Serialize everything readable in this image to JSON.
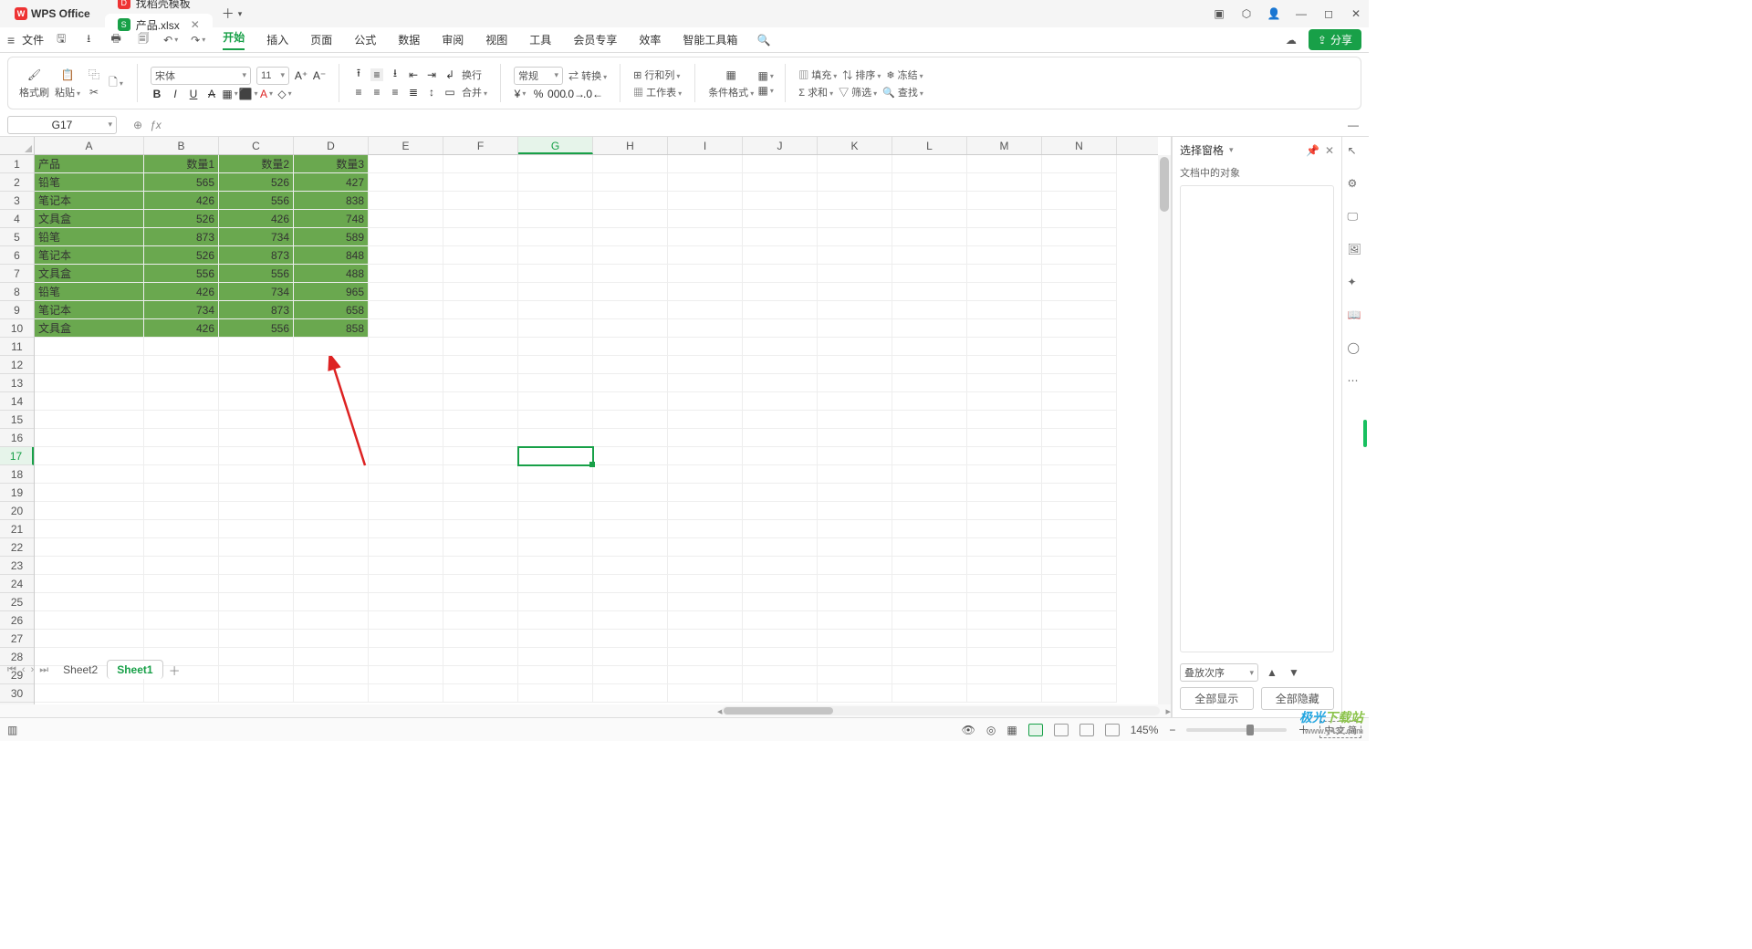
{
  "titlebar": {
    "app": "WPS Office",
    "tabs": [
      {
        "icon": "D",
        "icon_bg": "#e33",
        "label": "找稻壳模板"
      },
      {
        "icon": "S",
        "icon_bg": "#18a048",
        "label": "产品.xlsx",
        "active": true,
        "closable": true
      }
    ],
    "right_icons": [
      "window-mode-icon",
      "cube-icon",
      "avatar-icon",
      "minimize-icon",
      "maximize-icon",
      "close-icon"
    ]
  },
  "menubar": {
    "file_label": "文件",
    "quick_icons": [
      "save-icon",
      "print-icon",
      "print-preview-icon",
      "redo-dd-icon",
      "undo-icon",
      "undo-dd-icon"
    ],
    "tabs": [
      "开始",
      "插入",
      "页面",
      "公式",
      "数据",
      "审阅",
      "视图",
      "工具",
      "会员专享",
      "效率",
      "智能工具箱"
    ],
    "search_icon": "search-icon",
    "cloud_icon": "cloud-icon",
    "share_label": "分享"
  },
  "ribbon": {
    "format_brush": "格式刷",
    "paste": "粘贴",
    "font_name": "宋体",
    "font_size": "11",
    "format_group": {
      "convert": "转换",
      "row_col": "行和列",
      "worksheet": "工作表",
      "cond_fmt": "条件格式"
    },
    "number_format": "常规",
    "fill": "填充",
    "sort": "排序",
    "freeze": "冻结",
    "sum": "求和",
    "filter": "筛选",
    "find": "查找",
    "wrap_text": "换行",
    "merge": "合并"
  },
  "name_box": "G17",
  "columns": [
    "A",
    "B",
    "C",
    "D",
    "E",
    "F",
    "G",
    "H",
    "I",
    "J",
    "K",
    "L",
    "M",
    "N"
  ],
  "active_col_index": 6,
  "row_count": 30,
  "active_row": 17,
  "grid": {
    "headers": [
      "产品",
      "数量1",
      "数量2",
      "数量3"
    ],
    "rows": [
      [
        "铅笔",
        "565",
        "526",
        "427"
      ],
      [
        "笔记本",
        "426",
        "556",
        "838"
      ],
      [
        "文具盒",
        "526",
        "426",
        "748"
      ],
      [
        "铅笔",
        "873",
        "734",
        "589"
      ],
      [
        "笔记本",
        "526",
        "873",
        "848"
      ],
      [
        "文具盒",
        "556",
        "556",
        "488"
      ],
      [
        "铅笔",
        "426",
        "734",
        "965"
      ],
      [
        "笔记本",
        "734",
        "873",
        "658"
      ],
      [
        "文具盒",
        "426",
        "556",
        "858"
      ]
    ]
  },
  "right_pane": {
    "title": "选择窗格",
    "sub": "文档中的对象",
    "order": "叠放次序",
    "show_all": "全部显示",
    "hide_all": "全部隐藏"
  },
  "sheet_tabs": [
    "Sheet2",
    "Sheet1"
  ],
  "active_sheet_index": 1,
  "status": {
    "zoom": "145%",
    "ime": "中.文.简"
  },
  "watermark": {
    "brand": "极光下载站",
    "url": "www.y432.com"
  }
}
